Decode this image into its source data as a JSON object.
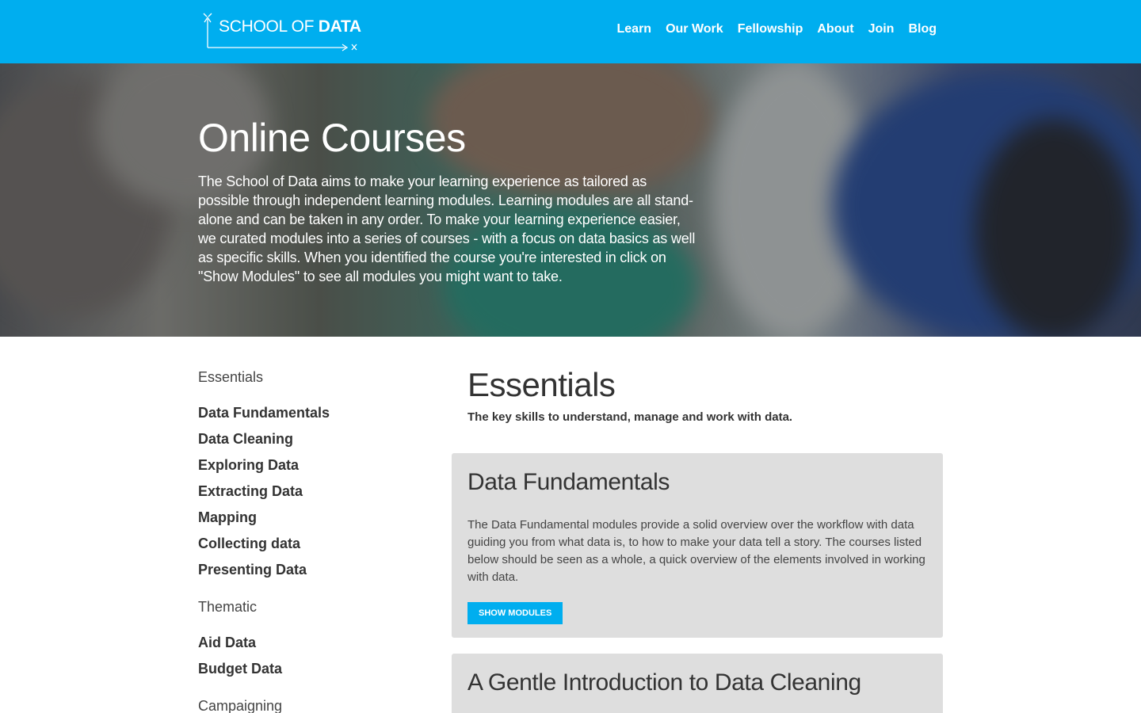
{
  "header": {
    "logo_text_1": "SCHOOL OF",
    "logo_text_2": "DATA",
    "nav": [
      "Learn",
      "Our Work",
      "Fellowship",
      "About",
      "Join",
      "Blog"
    ]
  },
  "hero": {
    "title": "Online Courses",
    "description": "The School of Data aims to make your learning experience as tailored as possible through independent learning modules. Learning modules are all stand-alone and can be taken in any order. To make your learning experience easier, we curated modules into a series of courses - with a focus on data basics as well as specific skills. When you identified the course you're interested in click on \"Show Modules\" to see all modules you might want to take."
  },
  "sidebar": {
    "groups": [
      {
        "title": "Essentials",
        "items": [
          "Data Fundamentals",
          "Data Cleaning",
          "Exploring Data",
          "Extracting Data",
          "Mapping",
          "Collecting data",
          "Presenting Data"
        ]
      },
      {
        "title": "Thematic",
        "items": [
          "Aid Data",
          "Budget Data"
        ]
      },
      {
        "title": "Campaigning",
        "items": []
      }
    ]
  },
  "main": {
    "section_title": "Essentials",
    "section_lead": "The key skills to understand, manage and work with data.",
    "cards": [
      {
        "title": "Data Fundamentals",
        "description": "The Data Fundamental modules provide a solid overview over the workflow with data guiding you from what data is, to how to make your data tell a story. The courses listed below should be seen as a whole, a quick overview of the elements involved in working with data.",
        "button": "SHOW MODULES"
      },
      {
        "title": "A Gentle Introduction to Data Cleaning"
      }
    ]
  },
  "colors": {
    "brand": "#00aeef",
    "card_bg": "#dedede"
  }
}
